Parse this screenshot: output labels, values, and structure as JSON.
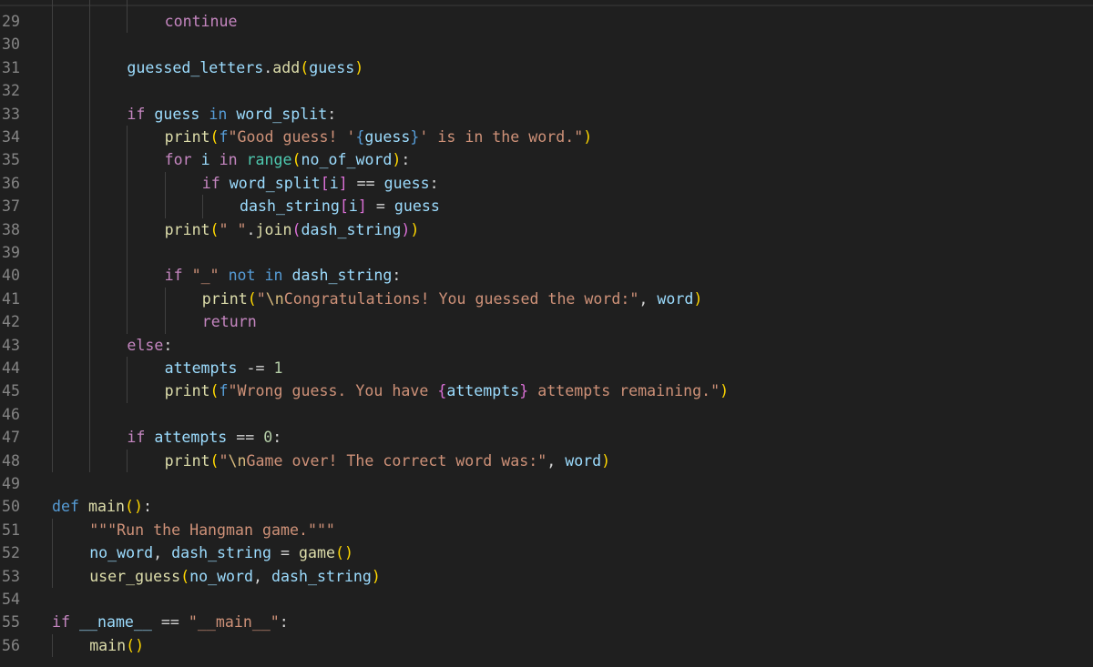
{
  "editor": {
    "language": "python",
    "lines": [
      {
        "n": "29",
        "indent": 3,
        "tokens": [
          [
            "ctl",
            "continue"
          ]
        ]
      },
      {
        "n": "30",
        "indent": 0,
        "tokens": []
      },
      {
        "n": "31",
        "indent": 2,
        "tokens": [
          [
            "var",
            "guessed_letters"
          ],
          [
            "op",
            "."
          ],
          [
            "fn",
            "add"
          ],
          [
            "p1",
            "("
          ],
          [
            "var",
            "guess"
          ],
          [
            "p1",
            ")"
          ]
        ]
      },
      {
        "n": "32",
        "indent": 0,
        "tokens": []
      },
      {
        "n": "33",
        "indent": 2,
        "tokens": [
          [
            "ctl",
            "if"
          ],
          [
            "op",
            " "
          ],
          [
            "var",
            "guess"
          ],
          [
            "op",
            " "
          ],
          [
            "kw",
            "in"
          ],
          [
            "op",
            " "
          ],
          [
            "var",
            "word_split"
          ],
          [
            "op",
            ":"
          ]
        ]
      },
      {
        "n": "34",
        "indent": 3,
        "tokens": [
          [
            "fn",
            "print"
          ],
          [
            "p1",
            "("
          ],
          [
            "kw",
            "f"
          ],
          [
            "str",
            "\"Good guess! '"
          ],
          [
            "kw",
            "{"
          ],
          [
            "var",
            "guess"
          ],
          [
            "kw",
            "}"
          ],
          [
            "str",
            "' is in the word.\""
          ],
          [
            "p1",
            ")"
          ]
        ]
      },
      {
        "n": "35",
        "indent": 3,
        "tokens": [
          [
            "ctl",
            "for"
          ],
          [
            "op",
            " "
          ],
          [
            "var",
            "i"
          ],
          [
            "op",
            " "
          ],
          [
            "ctl",
            "in"
          ],
          [
            "op",
            " "
          ],
          [
            "bi",
            "range"
          ],
          [
            "p1",
            "("
          ],
          [
            "var",
            "no_of_word"
          ],
          [
            "p1",
            ")"
          ],
          [
            "op",
            ":"
          ]
        ]
      },
      {
        "n": "36",
        "indent": 4,
        "tokens": [
          [
            "ctl",
            "if"
          ],
          [
            "op",
            " "
          ],
          [
            "var",
            "word_split"
          ],
          [
            "p2",
            "["
          ],
          [
            "var",
            "i"
          ],
          [
            "p2",
            "]"
          ],
          [
            "op",
            " == "
          ],
          [
            "var",
            "guess"
          ],
          [
            "op",
            ":"
          ]
        ]
      },
      {
        "n": "37",
        "indent": 5,
        "tokens": [
          [
            "var",
            "dash_string"
          ],
          [
            "p2",
            "["
          ],
          [
            "var",
            "i"
          ],
          [
            "p2",
            "]"
          ],
          [
            "op",
            " = "
          ],
          [
            "var",
            "guess"
          ]
        ]
      },
      {
        "n": "38",
        "indent": 3,
        "tokens": [
          [
            "fn",
            "print"
          ],
          [
            "p1",
            "("
          ],
          [
            "str",
            "\" \""
          ],
          [
            "op",
            "."
          ],
          [
            "fn",
            "join"
          ],
          [
            "p2",
            "("
          ],
          [
            "var",
            "dash_string"
          ],
          [
            "p2",
            ")"
          ],
          [
            "p1",
            ")"
          ]
        ]
      },
      {
        "n": "39",
        "indent": 0,
        "tokens": []
      },
      {
        "n": "40",
        "indent": 3,
        "tokens": [
          [
            "ctl",
            "if"
          ],
          [
            "op",
            " "
          ],
          [
            "str",
            "\"_\""
          ],
          [
            "op",
            " "
          ],
          [
            "kw",
            "not in"
          ],
          [
            "op",
            " "
          ],
          [
            "var",
            "dash_string"
          ],
          [
            "op",
            ":"
          ]
        ]
      },
      {
        "n": "41",
        "indent": 4,
        "tokens": [
          [
            "fn",
            "print"
          ],
          [
            "p1",
            "("
          ],
          [
            "str",
            "\""
          ],
          [
            "esc",
            "\\n"
          ],
          [
            "str",
            "Congratulations! You guessed the word:\""
          ],
          [
            "op",
            ", "
          ],
          [
            "var",
            "word"
          ],
          [
            "p1",
            ")"
          ]
        ]
      },
      {
        "n": "42",
        "indent": 4,
        "tokens": [
          [
            "ctl",
            "return"
          ]
        ]
      },
      {
        "n": "43",
        "indent": 2,
        "tokens": [
          [
            "ctl",
            "else"
          ],
          [
            "op",
            ":"
          ]
        ]
      },
      {
        "n": "44",
        "indent": 3,
        "tokens": [
          [
            "var",
            "attempts"
          ],
          [
            "op",
            " -= "
          ],
          [
            "num",
            "1"
          ]
        ]
      },
      {
        "n": "45",
        "indent": 3,
        "tokens": [
          [
            "fn",
            "print"
          ],
          [
            "p1",
            "("
          ],
          [
            "kw",
            "f"
          ],
          [
            "str",
            "\"Wrong guess. You have "
          ],
          [
            "p2",
            "{"
          ],
          [
            "var",
            "attempts"
          ],
          [
            "p2",
            "}"
          ],
          [
            "str",
            " attempts remaining.\""
          ],
          [
            "p1",
            ")"
          ]
        ]
      },
      {
        "n": "46",
        "indent": 0,
        "tokens": []
      },
      {
        "n": "47",
        "indent": 2,
        "tokens": [
          [
            "ctl",
            "if"
          ],
          [
            "op",
            " "
          ],
          [
            "var",
            "attempts"
          ],
          [
            "op",
            " == "
          ],
          [
            "num",
            "0"
          ],
          [
            "op",
            ":"
          ]
        ]
      },
      {
        "n": "48",
        "indent": 3,
        "tokens": [
          [
            "fn",
            "print"
          ],
          [
            "p1",
            "("
          ],
          [
            "str",
            "\""
          ],
          [
            "esc",
            "\\n"
          ],
          [
            "str",
            "Game over! The correct word was:\""
          ],
          [
            "op",
            ", "
          ],
          [
            "var",
            "word"
          ],
          [
            "p1",
            ")"
          ]
        ]
      },
      {
        "n": "49",
        "indent": 0,
        "tokens": []
      },
      {
        "n": "50",
        "indent": 0,
        "tokens": [
          [
            "kw",
            "def"
          ],
          [
            "op",
            " "
          ],
          [
            "fn",
            "main"
          ],
          [
            "p1",
            "()"
          ],
          [
            "op",
            ":"
          ]
        ]
      },
      {
        "n": "51",
        "indent": 1,
        "tokens": [
          [
            "str",
            "\"\"\"Run the Hangman game.\"\"\""
          ]
        ]
      },
      {
        "n": "52",
        "indent": 1,
        "tokens": [
          [
            "var",
            "no_word"
          ],
          [
            "op",
            ", "
          ],
          [
            "var",
            "dash_string"
          ],
          [
            "op",
            " = "
          ],
          [
            "fn",
            "game"
          ],
          [
            "p1",
            "()"
          ]
        ]
      },
      {
        "n": "53",
        "indent": 1,
        "tokens": [
          [
            "fn",
            "user_guess"
          ],
          [
            "p1",
            "("
          ],
          [
            "var",
            "no_word"
          ],
          [
            "op",
            ", "
          ],
          [
            "var",
            "dash_string"
          ],
          [
            "p1",
            ")"
          ]
        ]
      },
      {
        "n": "54",
        "indent": 0,
        "tokens": []
      },
      {
        "n": "55",
        "indent": 0,
        "tokens": [
          [
            "ctl",
            "if"
          ],
          [
            "op",
            " "
          ],
          [
            "var",
            "__name__"
          ],
          [
            "op",
            " == "
          ],
          [
            "str",
            "\"__main__\""
          ],
          [
            "op",
            ":"
          ]
        ]
      },
      {
        "n": "56",
        "indent": 1,
        "tokens": [
          [
            "fn",
            "main"
          ],
          [
            "p1",
            "()"
          ]
        ]
      }
    ]
  }
}
